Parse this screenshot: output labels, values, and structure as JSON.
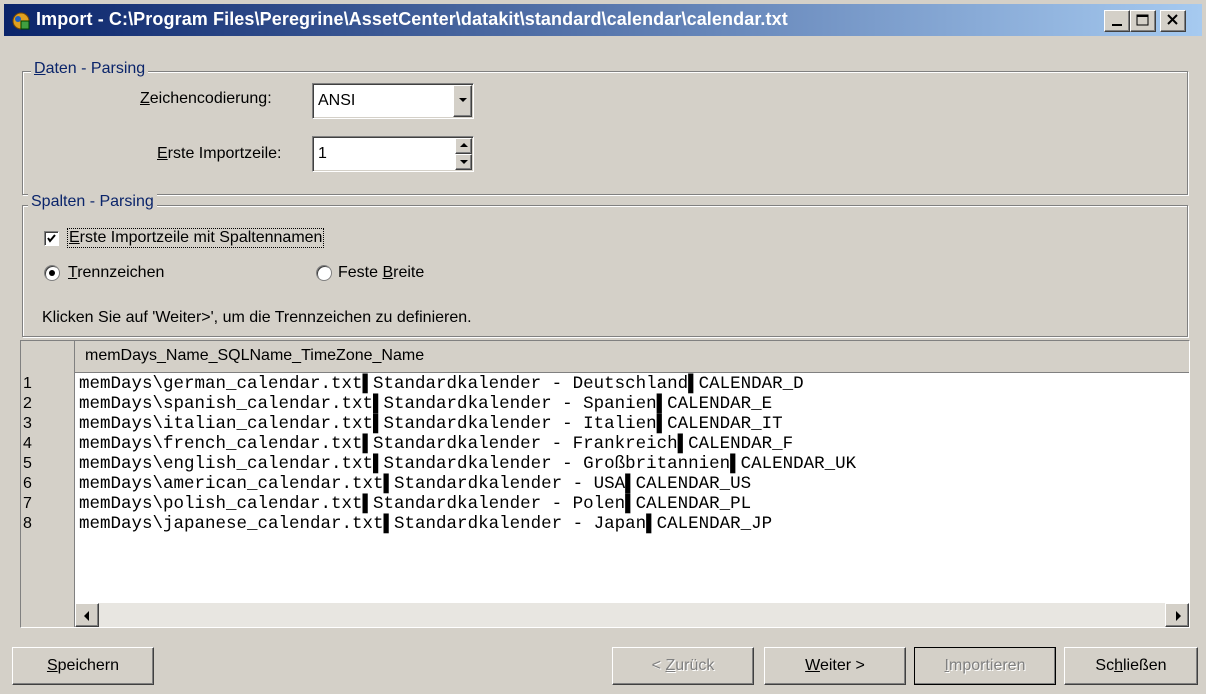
{
  "window": {
    "title": "Import - C:\\Program Files\\Peregrine\\AssetCenter\\datakit\\standard\\calendar\\calendar.txt"
  },
  "daten_parsing": {
    "legend": "Daten - Parsing",
    "encoding_label": "Zeichencodierung:",
    "encoding_value": "ANSI",
    "first_line_label": "Erste Importzeile:",
    "first_line_value": "1"
  },
  "spalten_parsing": {
    "legend": "Spalten - Parsing",
    "header_checkbox_label": "Erste Importzeile mit Spaltennamen",
    "header_checkbox_checked": true,
    "radio_delimiter_label": "Trennzeichen",
    "radio_delimiter_selected": true,
    "radio_fixed_label": "Feste Breite",
    "radio_fixed_selected": false,
    "hint": "Klicken Sie auf 'Weiter>', um die Trennzeichen zu definieren."
  },
  "preview": {
    "column_header": "memDays_Name_SQLName_TimeZone_Name",
    "rows": [
      {
        "num": "1",
        "text": "memDays\\german_calendar.txt▌Standardkalender - Deutschland▌CALENDAR_D"
      },
      {
        "num": "2",
        "text": "memDays\\spanish_calendar.txt▌Standardkalender - Spanien▌CALENDAR_E"
      },
      {
        "num": "3",
        "text": "memDays\\italian_calendar.txt▌Standardkalender - Italien▌CALENDAR_IT"
      },
      {
        "num": "4",
        "text": "memDays\\french_calendar.txt▌Standardkalender - Frankreich▌CALENDAR_F"
      },
      {
        "num": "5",
        "text": "memDays\\english_calendar.txt▌Standardkalender - Großbritannien▌CALENDAR_UK"
      },
      {
        "num": "6",
        "text": "memDays\\american_calendar.txt▌Standardkalender - USA▌CALENDAR_US"
      },
      {
        "num": "7",
        "text": "memDays\\polish_calendar.txt▌Standardkalender - Polen▌CALENDAR_PL"
      },
      {
        "num": "8",
        "text": "memDays\\japanese_calendar.txt▌Standardkalender - Japan▌CALENDAR_JP"
      }
    ]
  },
  "buttons": {
    "save": "Speichern",
    "back": "< Zurück",
    "next": "Weiter >",
    "import": "Importieren",
    "close": "Schließen"
  },
  "icons": {
    "app": "import-wizard-icon",
    "minimize": "minimize-icon",
    "maximize": "maximize-icon",
    "close": "close-icon"
  },
  "colors": {
    "title_gradient_start": "#0a246a",
    "title_gradient_end": "#a6caf0",
    "legend_text": "#0a246a",
    "face": "#d4d0c8"
  }
}
